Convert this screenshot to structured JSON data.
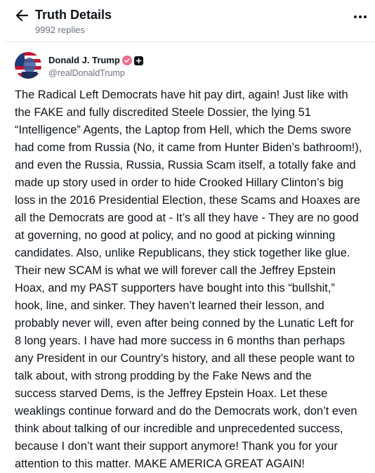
{
  "header": {
    "title": "Truth Details",
    "replies": "9992 replies",
    "back_icon": "arrow-left-icon",
    "more_icon": "more-horizontal-icon"
  },
  "post": {
    "author_name": "Donald J. Trump",
    "author_handle": "@realDonaldTrump",
    "verified_color": "#f06d8d",
    "text": "The Radical Left Democrats have hit pay dirt, again! Just like with\nthe FAKE and fully discredited Steele Dossier, the lying 51\n“Intelligence” Agents, the Laptop from Hell, which the Dems swore\nhad come from Russia (No, it came from Hunter Biden’s bathroom!),\nand even the Russia, Russia, Russia Scam itself, a totally fake and\nmade up story used in order to hide Crooked Hillary Clinton’s big\nloss in the 2016 Presidential Election, these Scams and Hoaxes are\nall the Democrats are good at - It’s all they have - They are no good\nat governing, no good at policy, and no good at picking winning\ncandidates. Also, unlike Republicans, they stick together like glue.\nTheir new SCAM is what we will forever call the Jeffrey Epstein\nHoax, and my PAST supporters have bought into this “bullshit,”\nhook, line, and sinker. They haven’t learned their lesson, and\nprobably never will, even after being conned by the Lunatic Left for\n8 long years. I have had more success in 6 months than perhaps\nany President in our Country’s history, and all these people want to\ntalk about, with strong prodding by the Fake News and the\nsuccess starved Dems, is the Jeffrey Epstein Hoax. Let these\nweaklings continue forward and do the Democrats work, don’t even\nthink about talking of our incredible and unprecedented success,\nbecause I don’t want their support anymore! Thank you for your\nattention to this matter. MAKE AMERICA GREAT AGAIN!"
  }
}
